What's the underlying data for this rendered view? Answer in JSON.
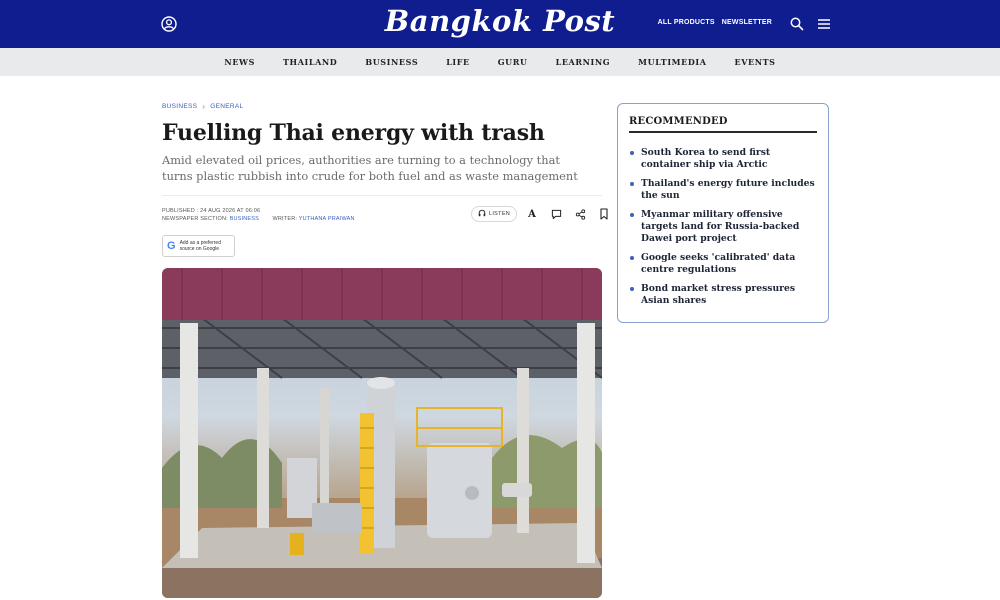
{
  "header": {
    "logo": "Bangkok Post",
    "links": [
      "ALL PRODUCTS",
      "NEWSLETTER"
    ],
    "icons": [
      "user-icon",
      "search-icon",
      "menu-icon"
    ],
    "background": "#0f1d8f"
  },
  "nav": {
    "items": [
      "NEWS",
      "THAILAND",
      "BUSINESS",
      "LIFE",
      "GURU",
      "LEARNING",
      "MULTIMEDIA",
      "EVENTS"
    ]
  },
  "article": {
    "breadcrumb": [
      "BUSINESS",
      "GENERAL"
    ],
    "headline": "Fuelling Thai energy with trash",
    "deck": "Amid elevated oil prices, authorities are turning to a technology that turns plastic rubbish into crude for both fuel and as waste management",
    "meta": {
      "published_label": "PUBLISHED : 24 AUG 2026 AT 06:06",
      "section_label": "NEWSPAPER SECTION:",
      "section_value": "BUSINESS",
      "writer_label": "WRITER:",
      "writer_value": "YUTHANA PRAIWAN"
    },
    "actions": {
      "listen": "LISTEN",
      "font_size": "A",
      "icons": [
        "headphones-icon",
        "comment-icon",
        "share-icon",
        "bookmark-icon"
      ]
    },
    "google_badge": {
      "line1": "Add as a preferred",
      "line2": "source on Google"
    }
  },
  "recommended": {
    "title": "RECOMMENDED",
    "items": [
      "South Korea to send first container ship via Arctic",
      "Thailand's energy future includes the sun",
      "Myanmar military offensive targets land for Russia-backed Dawei port project",
      "Google seeks 'calibrated' data centre regulations",
      "Bond market stress pressures Asian shares"
    ]
  }
}
